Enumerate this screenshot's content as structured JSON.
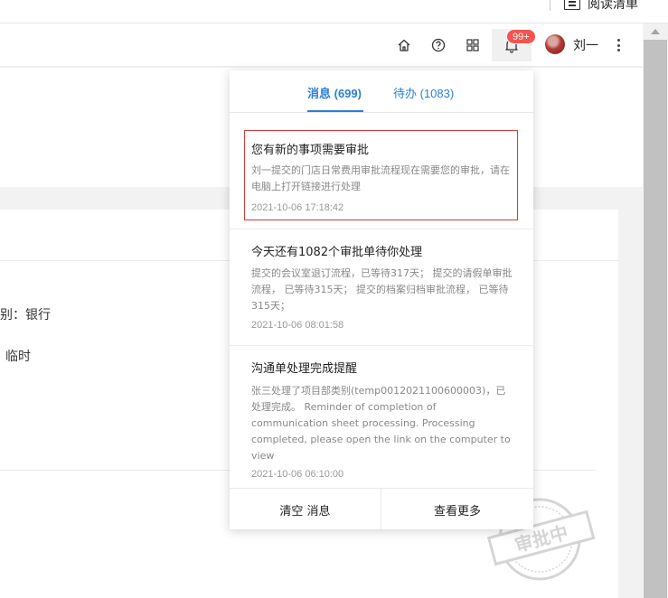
{
  "top_bar": {
    "reading_list_label": "阅读清单"
  },
  "header": {
    "badge": "99+",
    "username": "刘一"
  },
  "background": {
    "text1": "别：银行",
    "text2": "临时",
    "stamp_text": "审批中"
  },
  "panel": {
    "tabs": [
      {
        "label": "消息 (699)",
        "active": true
      },
      {
        "label": "待办 (1083)",
        "active": false
      }
    ],
    "messages": [
      {
        "title": "您有新的事项需要审批",
        "body": "刘一提交的门店日常费用审批流程现在需要您的审批，请在电脑上打开链接进行处理",
        "time": "2021-10-06 17:18:42",
        "highlighted": true
      },
      {
        "title": "今天还有1082个审批单待你处理",
        "body": "提交的会议室退订流程，已等待317天； 提交的请假单审批流程， 已等待315天； 提交的档案归档审批流程， 已等待315天；",
        "time": "2021-10-06 08:01:58",
        "highlighted": false
      },
      {
        "title": "沟通单处理完成提醒",
        "body": "张三处理了项目部类别(temp0012021100600003)，已处理完成。 Reminder of completion of communication sheet processing. Processing completed, please open the link on the computer to view",
        "time": "2021-10-06 06:10:00",
        "highlighted": false
      }
    ],
    "footer": {
      "clear_label": "清空 消息",
      "more_label": "查看更多"
    }
  },
  "colors": {
    "accent": "#2b7fd6",
    "badge": "#f5534f",
    "highlight_border": "#d33a3a"
  }
}
